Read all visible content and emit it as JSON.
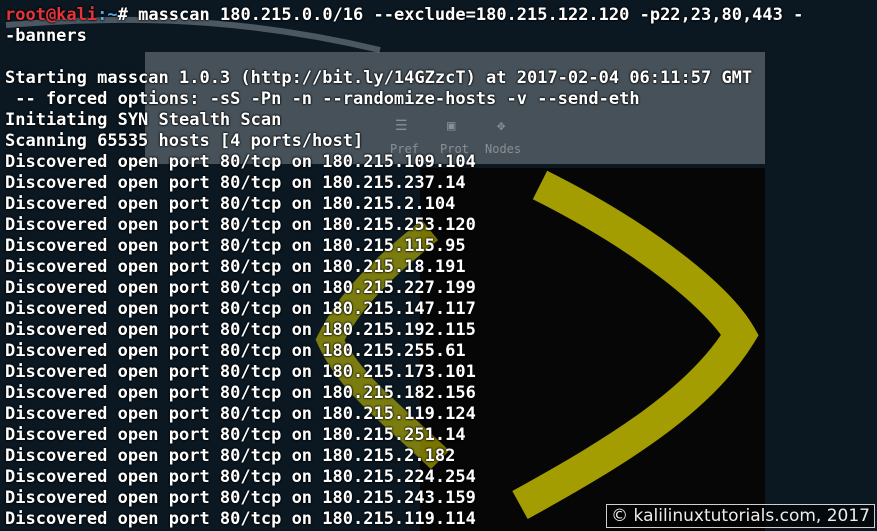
{
  "prompt": {
    "user": "root@kali",
    "path": ":~",
    "symbol": "# "
  },
  "command": {
    "line1": "masscan 180.215.0.0/16 --exclude=180.215.122.120 -p22,23,80,443 -",
    "line2": "-banners"
  },
  "output": [
    "",
    "Starting masscan 1.0.3 (http://bit.ly/14GZzcT) at 2017-02-04 06:11:57 GMT",
    " -- forced options: -sS -Pn -n --randomize-hosts -v --send-eth",
    "Initiating SYN Stealth Scan",
    "Scanning 65535 hosts [4 ports/host]",
    "Discovered open port 80/tcp on 180.215.109.104",
    "Discovered open port 80/tcp on 180.215.237.14",
    "Discovered open port 80/tcp on 180.215.2.104",
    "Discovered open port 80/tcp on 180.215.253.120",
    "Discovered open port 80/tcp on 180.215.115.95",
    "Discovered open port 80/tcp on 180.215.18.191",
    "Discovered open port 80/tcp on 180.215.227.199",
    "Discovered open port 80/tcp on 180.215.147.117",
    "Discovered open port 80/tcp on 180.215.192.115",
    "Discovered open port 80/tcp on 180.215.255.61",
    "Discovered open port 80/tcp on 180.215.173.101",
    "Discovered open port 80/tcp on 180.215.182.156",
    "Discovered open port 80/tcp on 180.215.119.124",
    "Discovered open port 80/tcp on 180.215.251.14",
    "Discovered open port 80/tcp on 180.215.2.182",
    "Discovered open port 80/tcp on 180.215.224.254",
    "Discovered open port 80/tcp on 180.215.243.159",
    "Discovered open port 80/tcp on 180.215.119.114"
  ],
  "background_toolbar": {
    "pref": "Pref",
    "prot": "Prot",
    "nodes": "Nodes"
  },
  "watermark": "© kalilinuxtutorials.com, 2017",
  "colors": {
    "user": "#e8333a",
    "path": "#5aa6e0",
    "text": "#ffffff",
    "background": "#0b1822",
    "graph": "#d8d000"
  }
}
